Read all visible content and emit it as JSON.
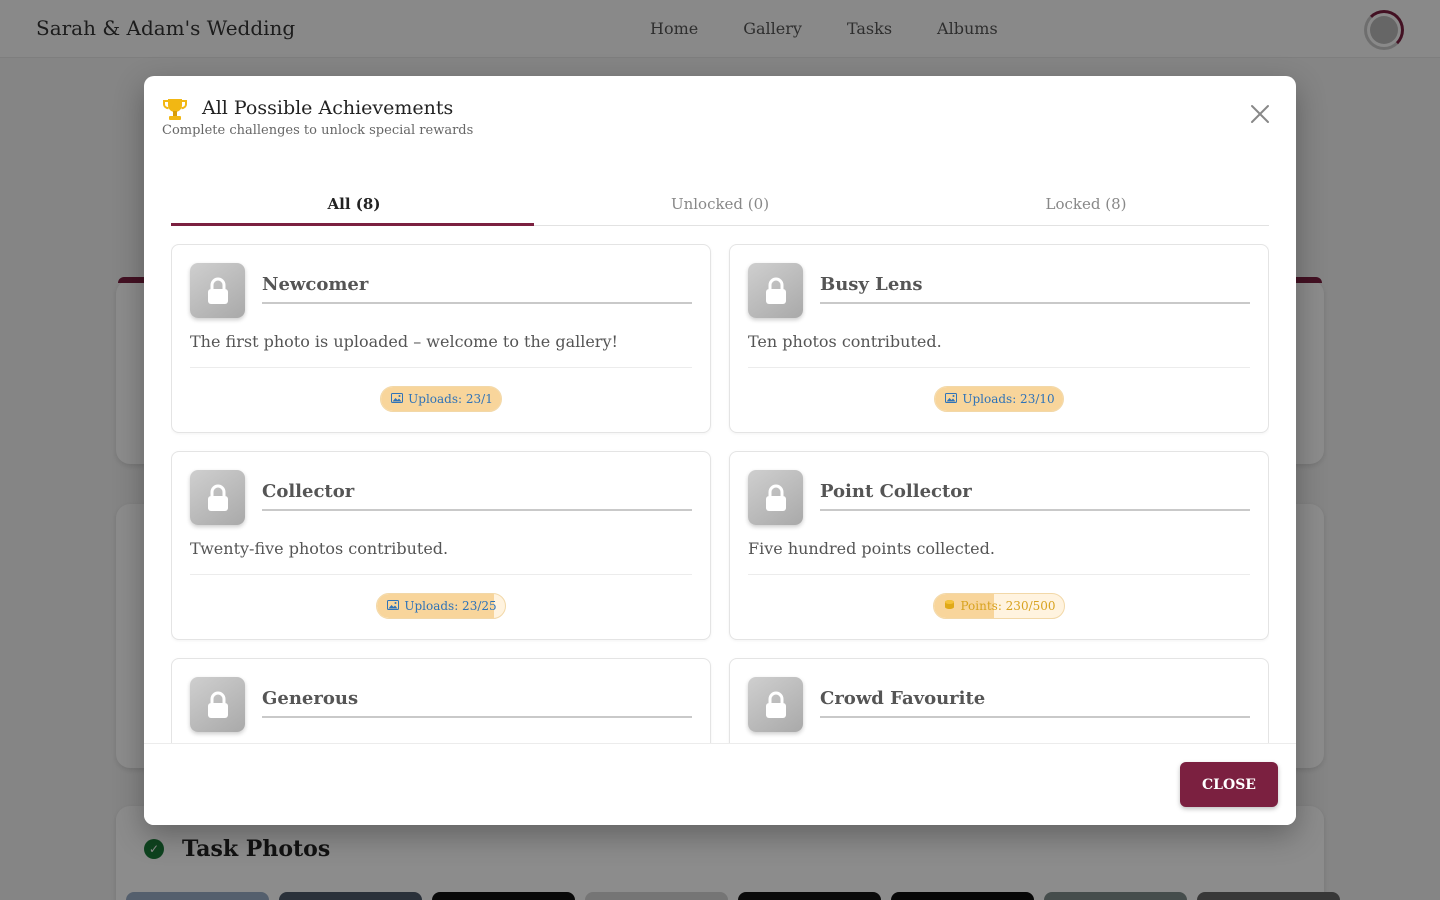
{
  "header": {
    "brand": "Sarah & Adam's Wedding",
    "nav": [
      "Home",
      "Gallery",
      "Tasks",
      "Albums"
    ]
  },
  "background": {
    "task_section_title": "Task Photos"
  },
  "modal": {
    "title": "All Possible Achievements",
    "subtitle": "Complete challenges to unlock special rewards",
    "tabs": [
      {
        "label": "All (8)",
        "active": true
      },
      {
        "label": "Unlocked (0)",
        "active": false
      },
      {
        "label": "Locked (8)",
        "active": false
      }
    ],
    "achievements": [
      {
        "title": "Newcomer",
        "description": "The first photo is uploaded – welcome to the gallery!",
        "kind": "upload",
        "progress_label": "Uploads: 23/1",
        "progress": 1.0
      },
      {
        "title": "Busy Lens",
        "description": "Ten photos contributed.",
        "kind": "upload",
        "progress_label": "Uploads: 23/10",
        "progress": 1.0
      },
      {
        "title": "Collector",
        "description": "Twenty-five photos contributed.",
        "kind": "upload",
        "progress_label": "Uploads: 23/25",
        "progress": 0.92
      },
      {
        "title": "Point Collector",
        "description": "Five hundred points collected.",
        "kind": "points",
        "progress_label": "Points: 230/500",
        "progress": 0.46
      },
      {
        "title": "Generous",
        "description": "",
        "kind": "upload",
        "progress_label": "",
        "progress": 0
      },
      {
        "title": "Crowd Favourite",
        "description": "",
        "kind": "upload",
        "progress_label": "",
        "progress": 0
      }
    ],
    "close_button": "CLOSE"
  },
  "colors": {
    "accent": "#7b2040",
    "upload_text": "#2f73b8",
    "points_text": "#d8a21f",
    "pill_fill": "#f8d59b"
  }
}
